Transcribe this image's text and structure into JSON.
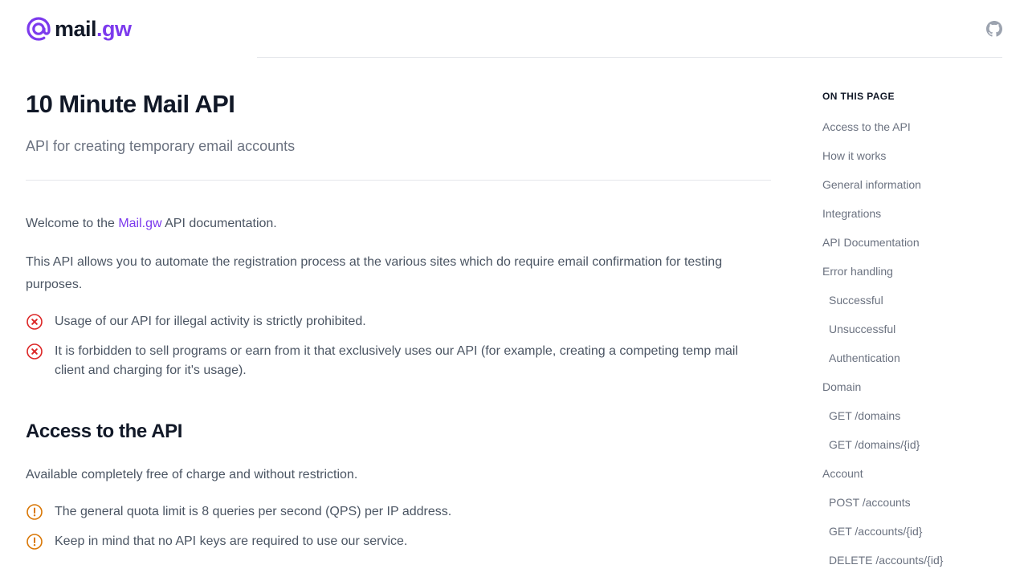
{
  "header": {
    "logo_text_main": "mail",
    "logo_text_accent": ".gw",
    "brand_color": "#7c3aed",
    "github_icon": "github-icon"
  },
  "main": {
    "title": "10 Minute Mail API",
    "subtitle": "API for creating temporary email accounts",
    "intro": {
      "before": "Welcome to the ",
      "link": "Mail.gw",
      "after": " API documentation."
    },
    "description": "This API allows you to automate the registration process at the various sites which do require email confirmation for testing purposes.",
    "warnings": [
      "Usage of our API for illegal activity is strictly prohibited.",
      "It is forbidden to sell programs or earn from it that exclusively uses our API (for example, creating a competing temp mail client and charging for it's usage)."
    ],
    "access": {
      "heading": "Access to the API",
      "text": "Available completely free of charge and without restriction.",
      "notes": [
        "The general quota limit is 8 queries per second (QPS) per IP address.",
        "Keep in mind that no API keys are required to use our service."
      ]
    },
    "colors": {
      "error": "#dc2626",
      "warning": "#d97706"
    }
  },
  "toc": {
    "title": "ON THIS PAGE",
    "items": [
      {
        "label": "Access to the API",
        "level": 1
      },
      {
        "label": "How it works",
        "level": 1
      },
      {
        "label": "General information",
        "level": 1
      },
      {
        "label": "Integrations",
        "level": 1
      },
      {
        "label": "API Documentation",
        "level": 1
      },
      {
        "label": "Error handling",
        "level": 1
      },
      {
        "label": "Successful",
        "level": 2
      },
      {
        "label": "Unsuccessful",
        "level": 2
      },
      {
        "label": "Authentication",
        "level": 2
      },
      {
        "label": "Domain",
        "level": 1
      },
      {
        "label": "GET /domains",
        "level": 2
      },
      {
        "label": "GET /domains/{id}",
        "level": 2
      },
      {
        "label": "Account",
        "level": 1
      },
      {
        "label": "POST /accounts",
        "level": 2
      },
      {
        "label": "GET /accounts/{id}",
        "level": 2
      },
      {
        "label": "DELETE /accounts/{id}",
        "level": 2
      }
    ]
  }
}
